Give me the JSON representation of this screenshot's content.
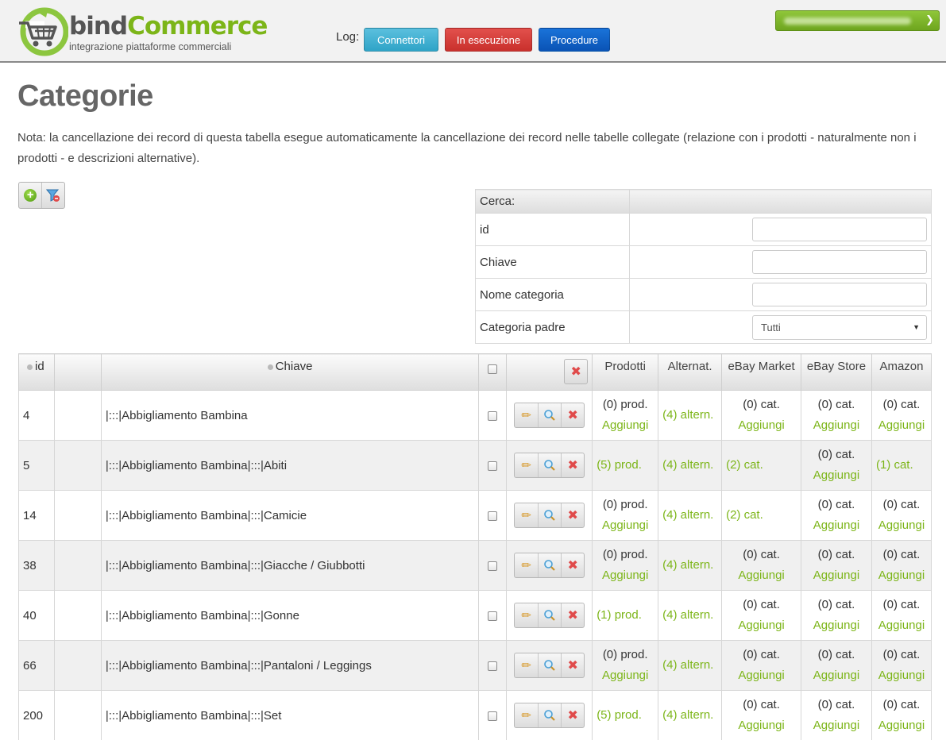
{
  "header": {
    "logo": {
      "brand_a": "bind",
      "brand_b": "Commerce",
      "tagline": "integrazione piattaforme commerciali"
    },
    "log_label": "Log:",
    "buttons": {
      "connettori": "Connettori",
      "in_esecuzione": "In esecuzione",
      "procedure": "Procedure"
    },
    "colors": {
      "accent_green": "#7cb518",
      "info": "#5bc0de",
      "danger": "#d9534f",
      "primary": "#0a53b5"
    }
  },
  "page": {
    "title": "Categorie",
    "note": "Nota: la cancellazione dei record di questa tabella esegue automaticamente la cancellazione dei record nelle tabelle collegate (relazione con i prodotti - naturalmente non i prodotti - e descrizioni alternative)."
  },
  "search": {
    "title": "Cerca:",
    "fields": {
      "id": {
        "label": "id",
        "value": ""
      },
      "chiave": {
        "label": "Chiave",
        "value": ""
      },
      "nome": {
        "label": "Nome categoria",
        "value": ""
      },
      "padre": {
        "label": "Categoria padre",
        "value": "Tutti"
      }
    }
  },
  "grid": {
    "columns": {
      "id": "id",
      "chiave": "Chiave",
      "prodotti": "Prodotti",
      "alternat": "Alternat.",
      "ebay_market": "eBay Market",
      "ebay_store": "eBay Store",
      "amazon": "Amazon"
    },
    "add_link": "Aggiungi",
    "rows": [
      {
        "id": "4",
        "chiave": "|:::|Abbigliamento Bambina",
        "prod": "(0) prod.",
        "alt": "(4) altern.",
        "ebm": "(0) cat.",
        "ebs": "(0) cat.",
        "amz": "(0) cat."
      },
      {
        "id": "5",
        "chiave": "|:::|Abbigliamento Bambina|:::|Abiti",
        "prod": "(5) prod.",
        "alt": "(4) altern.",
        "ebm": "(2) cat.",
        "ebs": "(0) cat.",
        "amz": "(1) cat."
      },
      {
        "id": "14",
        "chiave": "|:::|Abbigliamento Bambina|:::|Camicie",
        "prod": "(0) prod.",
        "alt": "(4) altern.",
        "ebm": "(2) cat.",
        "ebs": "(0) cat.",
        "amz": "(0) cat."
      },
      {
        "id": "38",
        "chiave": "|:::|Abbigliamento Bambina|:::|Giacche / Giubbotti",
        "prod": "(0) prod.",
        "alt": "(4) altern.",
        "ebm": "(0) cat.",
        "ebs": "(0) cat.",
        "amz": "(0) cat."
      },
      {
        "id": "40",
        "chiave": "|:::|Abbigliamento Bambina|:::|Gonne",
        "prod": "(1) prod.",
        "alt": "(4) altern.",
        "ebm": "(0) cat.",
        "ebs": "(0) cat.",
        "amz": "(0) cat."
      },
      {
        "id": "66",
        "chiave": "|:::|Abbigliamento Bambina|:::|Pantaloni / Leggings",
        "prod": "(0) prod.",
        "alt": "(4) altern.",
        "ebm": "(0) cat.",
        "ebs": "(0) cat.",
        "amz": "(0) cat."
      },
      {
        "id": "200",
        "chiave": "|:::|Abbigliamento Bambina|:::|Set",
        "prod": "(5) prod.",
        "alt": "(4) altern.",
        "ebm": "(0) cat.",
        "ebs": "(0) cat.",
        "amz": "(0) cat."
      }
    ]
  }
}
